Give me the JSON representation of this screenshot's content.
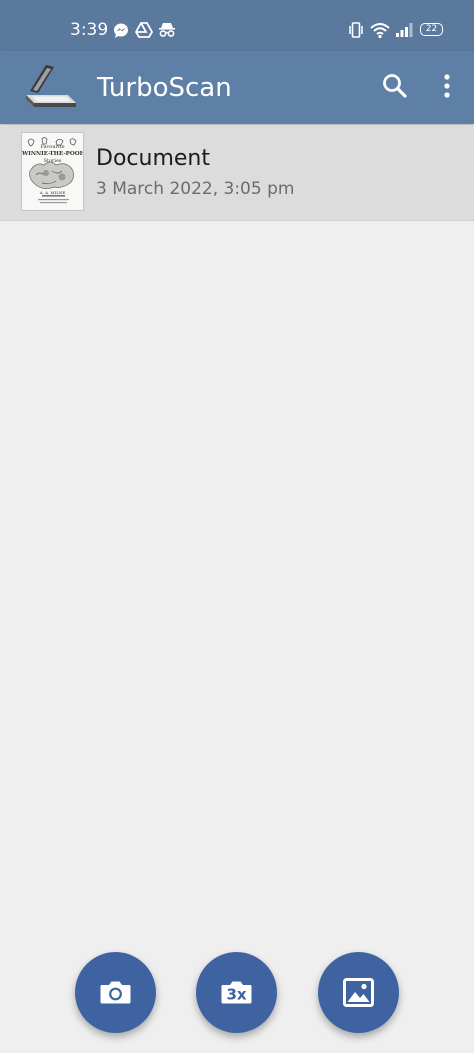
{
  "status_bar": {
    "time": "3:39",
    "icons_left": [
      "messenger-icon",
      "drive-icon",
      "incognito-icon"
    ],
    "icons_right": [
      "vibrate-icon",
      "wifi-icon",
      "signal-icon"
    ],
    "battery_level": "22"
  },
  "app_bar": {
    "title": "TurboScan",
    "logo_icon": "scanner-logo-icon",
    "actions": [
      "search-icon",
      "more-vert-icon"
    ],
    "color": "#5e7fa6"
  },
  "documents": [
    {
      "title": "Document",
      "date": "3 March 2022, 3:05 pm",
      "thumbnail": {
        "line1": "Favourite",
        "line2": "WINNIE-THE-POOH",
        "line3": "Stories",
        "line4": "A. A. MILNE"
      }
    }
  ],
  "fabs": [
    {
      "name": "camera-button",
      "icon": "camera-icon"
    },
    {
      "name": "camera-3x-button",
      "icon": "camera-3x-icon",
      "label": "3x"
    },
    {
      "name": "gallery-button",
      "icon": "image-icon"
    }
  ],
  "colors": {
    "status_bar": "#5a799c",
    "app_bar": "#5e7fa6",
    "background": "#efefef",
    "selected_row": "#dcdcdc",
    "fab": "#3f63a1"
  }
}
